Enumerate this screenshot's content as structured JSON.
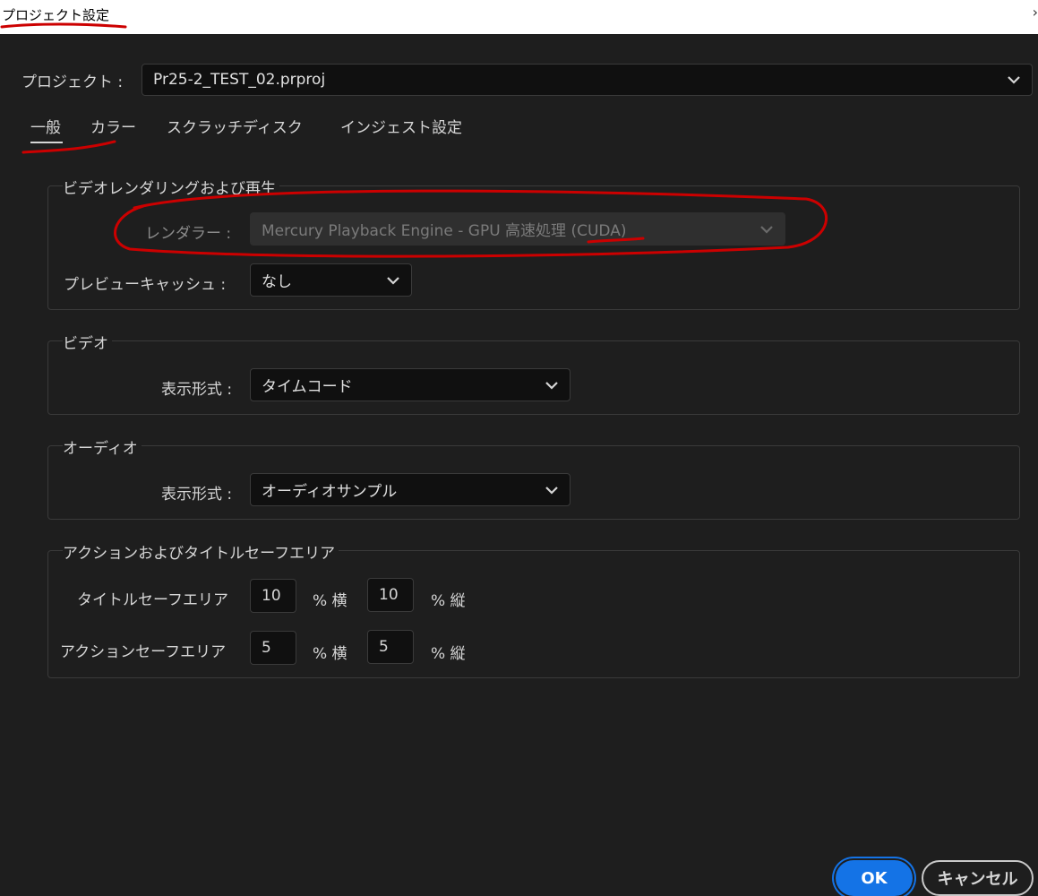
{
  "window": {
    "title": "プロジェクト設定",
    "close_glyph": "›"
  },
  "project": {
    "label": "プロジェクト :",
    "value": "Pr25-2_TEST_02.prproj"
  },
  "tabs": [
    {
      "label": "一般",
      "selected": true
    },
    {
      "label": "カラー"
    },
    {
      "label": "スクラッチディスク"
    },
    {
      "label": "インジェスト設定"
    }
  ],
  "rendering": {
    "title": "ビデオレンダリングおよび再生",
    "renderer_label": "レンダラー :",
    "renderer_value": "Mercury Playback Engine - GPU 高速処理 (CUDA)",
    "preview_cache_label": "プレビューキャッシュ :",
    "preview_cache_value": "なし"
  },
  "video": {
    "title": "ビデオ",
    "format_label": "表示形式 :",
    "format_value": "タイムコード"
  },
  "audio": {
    "title": "オーディオ",
    "format_label": "表示形式 :",
    "format_value": "オーディオサンプル"
  },
  "safe_area": {
    "title": "アクションおよびタイトルセーフエリア",
    "title_safe_label": "タイトルセーフエリア",
    "title_safe_h": "10",
    "title_safe_v": "10",
    "action_safe_label": "アクションセーフエリア",
    "action_safe_h": "5",
    "action_safe_v": "5",
    "unit_h": "% 横",
    "unit_v": "% 縦"
  },
  "buttons": {
    "ok": "OK",
    "cancel": "キャンセル"
  },
  "colors": {
    "background": "#1e1e1e",
    "accent": "#1473e6",
    "annotation": "#cc0000"
  }
}
